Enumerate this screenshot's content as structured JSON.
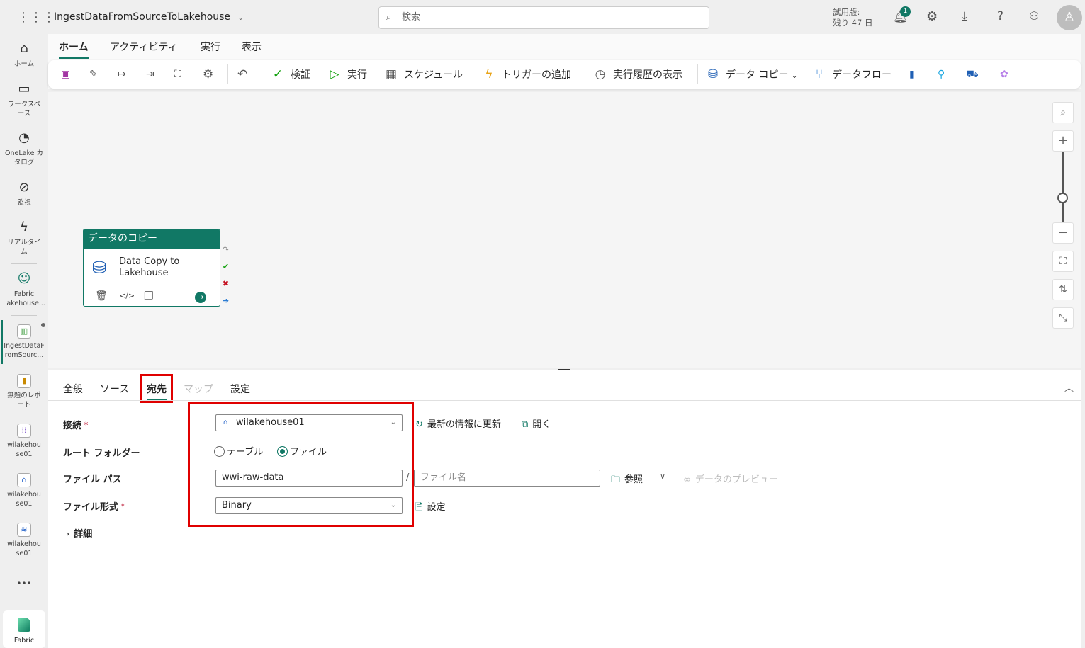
{
  "header": {
    "title": "IngestDataFromSourceToLakehouse",
    "search_placeholder": "検索",
    "trial_line1": "試用版:",
    "trial_line2": "残り 47 日",
    "notification_count": "1"
  },
  "rail": {
    "items": [
      {
        "label": "ホーム",
        "icon": "home-icon"
      },
      {
        "label": "ワークスペース",
        "icon": "workspaces-icon"
      },
      {
        "label": "OneLake カタログ",
        "icon": "onelake-icon"
      },
      {
        "label": "監視",
        "icon": "monitor-icon"
      },
      {
        "label": "リアルタイム",
        "icon": "realtime-icon"
      },
      {
        "label": "Fabric Lakehouse...",
        "icon": "lakehouse-people-icon"
      },
      {
        "label": "IngestDataFromSourc...",
        "icon": "pipeline-icon"
      },
      {
        "label": "無題のレポート",
        "icon": "report-icon"
      },
      {
        "label": "wilakehouse01",
        "icon": "lakehouse-dots-icon"
      },
      {
        "label": "wilakehouse01",
        "icon": "lakehouse-house-icon"
      },
      {
        "label": "wilakehouse01",
        "icon": "lakehouse-wave-icon"
      }
    ],
    "more": "•••",
    "fabric": "Fabric"
  },
  "ribbon": {
    "tabs": [
      "ホーム",
      "アクティビティ",
      "実行",
      "表示"
    ],
    "active_tab": "ホーム",
    "toolbar": {
      "validate": "検証",
      "run": "実行",
      "schedule": "スケジュール",
      "trigger": "トリガーの追加",
      "history": "実行履歴の表示",
      "copy_data": "データ コピー",
      "dataflow": "データフロー"
    }
  },
  "canvas": {
    "node": {
      "header": "データのコピー",
      "name": "Data Copy to Lakehouse"
    }
  },
  "panel": {
    "tabs": [
      "全般",
      "ソース",
      "宛先",
      "マップ",
      "設定"
    ],
    "active_tab": "宛先",
    "connection": {
      "label": "接続",
      "value": "wilakehouse01",
      "refresh": "最新の情報に更新",
      "open": "開く"
    },
    "root_folder": {
      "label": "ルート フォルダー",
      "options": [
        "テーブル",
        "ファイル"
      ],
      "selected": "ファイル"
    },
    "file_path": {
      "label": "ファイル パス",
      "folder": "wwi-raw-data",
      "separator": "/",
      "file_placeholder": "ファイル名",
      "browse": "参照",
      "preview": "データのプレビュー"
    },
    "file_format": {
      "label": "ファイル形式",
      "value": "Binary",
      "settings": "設定"
    },
    "advanced": "詳細"
  },
  "colors": {
    "accent": "#117865",
    "highlight": "#e00000"
  }
}
